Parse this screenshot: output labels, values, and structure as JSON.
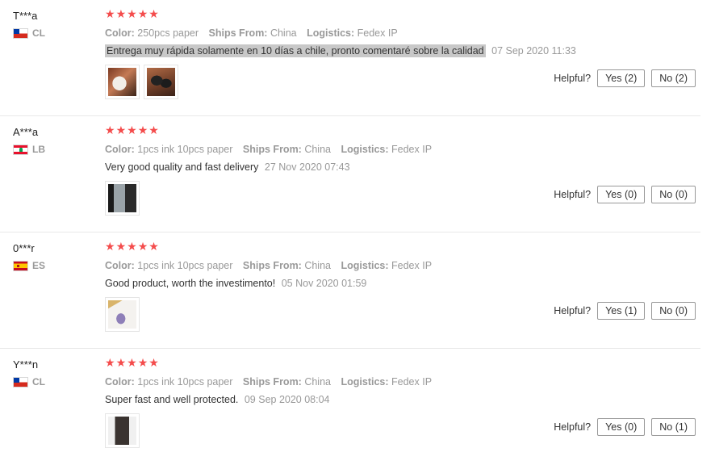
{
  "labels": {
    "color": "Color:",
    "ships_from": "Ships From:",
    "logistics": "Logistics:",
    "helpful": "Helpful?"
  },
  "colors": {
    "star": "#f44c4c",
    "muted_text": "#999999",
    "highlight": "#c8c8c8"
  },
  "reviews": [
    {
      "user": "T***a",
      "country": "CL",
      "flag_icon": "chile-flag-icon",
      "rating": 5,
      "color": "250pcs paper",
      "ships_from": "China",
      "logistics": "Fedex IP",
      "text": "Entrega muy rápida solamente en 10 días a chile, pronto comentaré sobre la calidad",
      "text_highlighted": true,
      "date": "07 Sep 2020 11:33",
      "photo_count": 2,
      "yes_label": "Yes (2)",
      "no_label": "No (2)"
    },
    {
      "user": "A***a",
      "country": "LB",
      "flag_icon": "lebanon-flag-icon",
      "rating": 5,
      "color": "1pcs ink 10pcs paper",
      "ships_from": "China",
      "logistics": "Fedex IP",
      "text": "Very good quality and fast delivery",
      "text_highlighted": false,
      "date": "27 Nov 2020 07:43",
      "photo_count": 1,
      "yes_label": "Yes (0)",
      "no_label": "No (0)"
    },
    {
      "user": "0***r",
      "country": "ES",
      "flag_icon": "spain-flag-icon",
      "rating": 5,
      "color": "1pcs ink 10pcs paper",
      "ships_from": "China",
      "logistics": "Fedex IP",
      "text": "Good product, worth the investimento!",
      "text_highlighted": false,
      "date": "05 Nov 2020 01:59",
      "photo_count": 1,
      "yes_label": "Yes (1)",
      "no_label": "No (0)"
    },
    {
      "user": "Y***n",
      "country": "CL",
      "flag_icon": "chile-flag-icon",
      "rating": 5,
      "color": "1pcs ink 10pcs paper",
      "ships_from": "China",
      "logistics": "Fedex IP",
      "text": "Super fast and well protected.",
      "text_highlighted": false,
      "date": "09 Sep 2020 08:04",
      "photo_count": 1,
      "yes_label": "Yes (0)",
      "no_label": "No (1)"
    }
  ]
}
